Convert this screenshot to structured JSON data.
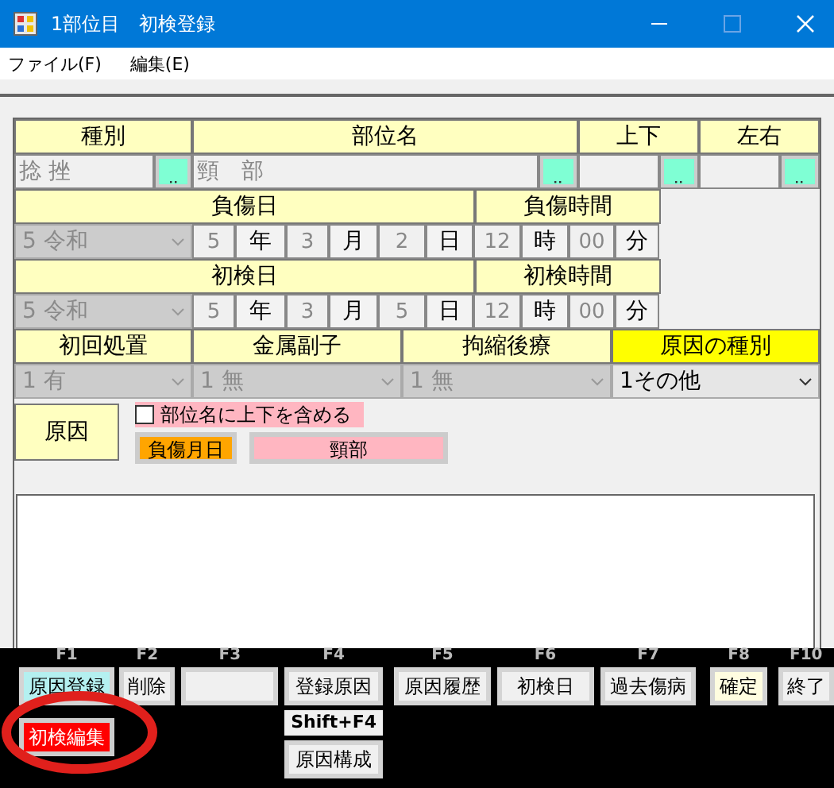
{
  "window": {
    "title": "1部位目　初検登録"
  },
  "menu": [
    {
      "label": "ファイル(F)"
    },
    {
      "label": "編集(E)"
    }
  ],
  "location": [
    {
      "header": "種別",
      "value": "捻 挫",
      "disabled": true
    },
    {
      "header": "部位名",
      "value": "頸　部",
      "disabled": true
    },
    {
      "header": "上下",
      "disabled": true
    },
    {
      "header": "左右",
      "disabled": true
    }
  ],
  "dates": [
    {
      "header": "負傷日",
      "era": "5 令和",
      "disabled": true,
      "parts": [
        {
          "value": "5",
          "unit": "年"
        },
        {
          "value": "3",
          "unit": "月"
        },
        {
          "value": "2",
          "unit": "日"
        }
      ],
      "time_header": "負傷時間",
      "time": [
        {
          "value": "12",
          "unit": "時"
        },
        {
          "value": "00",
          "unit": "分"
        }
      ]
    },
    {
      "header": "初検日",
      "era": "5 令和",
      "disabled": true,
      "parts": [
        {
          "value": "5",
          "unit": "年"
        },
        {
          "value": "3",
          "unit": "月"
        },
        {
          "value": "5",
          "unit": "日"
        }
      ],
      "time_header": "初検時間",
      "time": [
        {
          "value": "12",
          "unit": "時"
        },
        {
          "value": "00",
          "unit": "分"
        }
      ]
    }
  ],
  "treatment": [
    {
      "header": "初回処置",
      "value": "1 有",
      "disabled": true,
      "highlighted": false
    },
    {
      "header": "金属副子",
      "value": "1 無",
      "disabled": true,
      "highlighted": false
    },
    {
      "header": "拘縮後療",
      "value": "1 無",
      "disabled": true,
      "highlighted": false
    },
    {
      "header": "原因の種別",
      "value": "1その他",
      "disabled": false,
      "highlighted": true
    }
  ],
  "cause": {
    "label": "原因",
    "checkbox": {
      "label": "部位名に上下を含める",
      "checked": false
    },
    "date_button": "負傷月日",
    "part_button": "頸部"
  },
  "function_keys": [
    {
      "key": "F1",
      "label": "原因登録",
      "color": "#b4f0f0"
    },
    {
      "key": "F2",
      "label": "削除",
      "color": "#f0f0f0"
    },
    {
      "key": "F3",
      "color": "#f0f0f0"
    },
    {
      "key": "F4",
      "label": "登録原因",
      "color": "#f0f0f0"
    },
    {
      "key": "F5",
      "label": "原因履歴",
      "color": "#f0f0f0"
    },
    {
      "key": "F6",
      "label": "初検日",
      "color": "#f0f0f0"
    },
    {
      "key": "F7",
      "label": "過去傷病",
      "color": "#f0f0f0"
    },
    {
      "key": "F8",
      "label": "確定",
      "color": "#fffde0"
    },
    {
      "key": "F10",
      "label": "終了",
      "color": "#f0f0f0"
    }
  ],
  "edit_button": "初検編集",
  "shift_key": "Shift+F4",
  "shift_button": "原因構成"
}
